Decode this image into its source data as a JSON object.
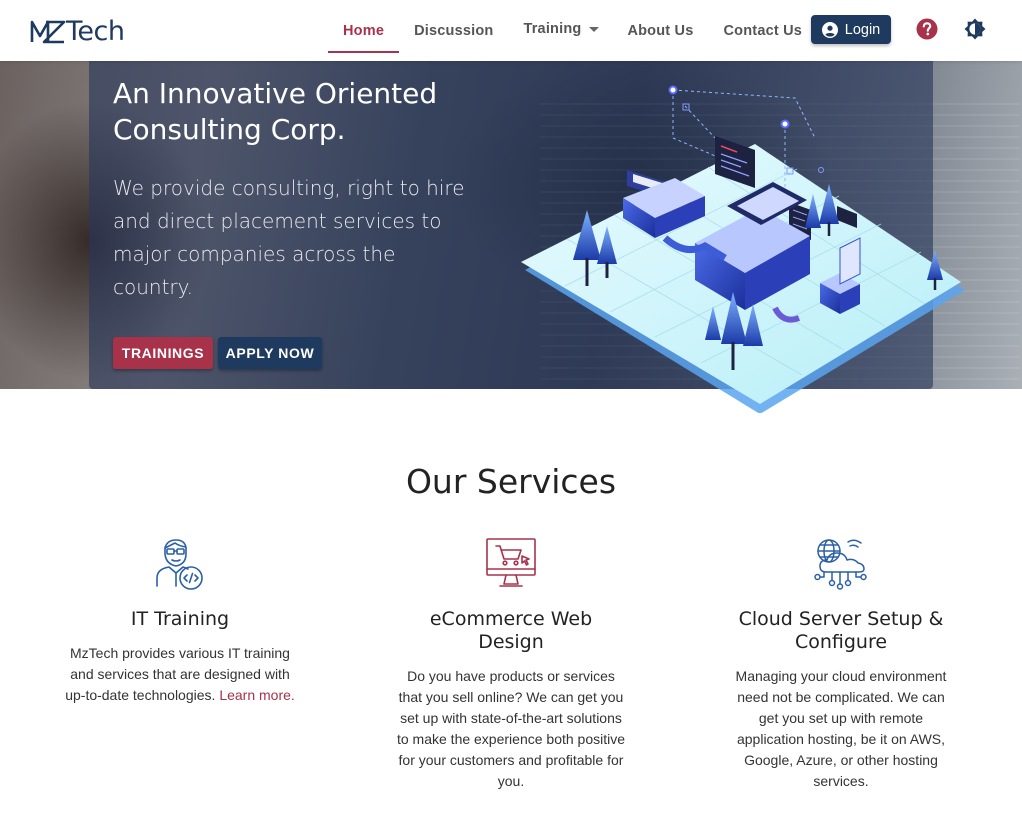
{
  "header": {
    "logo_text": "Tech",
    "nav": [
      {
        "label": "Home",
        "active": true
      },
      {
        "label": "Discussion"
      },
      {
        "label": "Training"
      },
      {
        "label": "About Us"
      },
      {
        "label": "Contact Us"
      }
    ],
    "login_label": "Login",
    "icons": {
      "user": "account-circle-icon",
      "help": "help-circle-icon",
      "theme": "brightness-icon"
    }
  },
  "hero": {
    "title": "An Innovative Oriented Consulting Corp.",
    "subtitle": "We provide consulting, right to hire and direct placement services to major companies across the country.",
    "primary_button": "TRAININGS",
    "secondary_button": "APPLY NOW"
  },
  "services": {
    "heading": "Our Services",
    "items": [
      {
        "icon": "developer-icon",
        "title": "IT Training",
        "body": "MzTech provides various IT training and services that are designed with up-to-date technologies.",
        "link": "Learn more."
      },
      {
        "icon": "ecommerce-cart-icon",
        "title": "eCommerce Web Design",
        "body": "Do you have products or services that you sell online? We can get you set up with state-of-the-art solutions to make the experience both positive for your customers and profitable for you."
      },
      {
        "icon": "cloud-network-icon",
        "title": "Cloud Server Setup & Configure",
        "body": "Managing your cloud environment need not be complicated. We can get you set up with remote application hosting, be it on AWS, Google, Azure, or other hosting services."
      }
    ]
  },
  "colors": {
    "brand_navy": "#1f3a5f",
    "accent_red": "#a8324a"
  }
}
